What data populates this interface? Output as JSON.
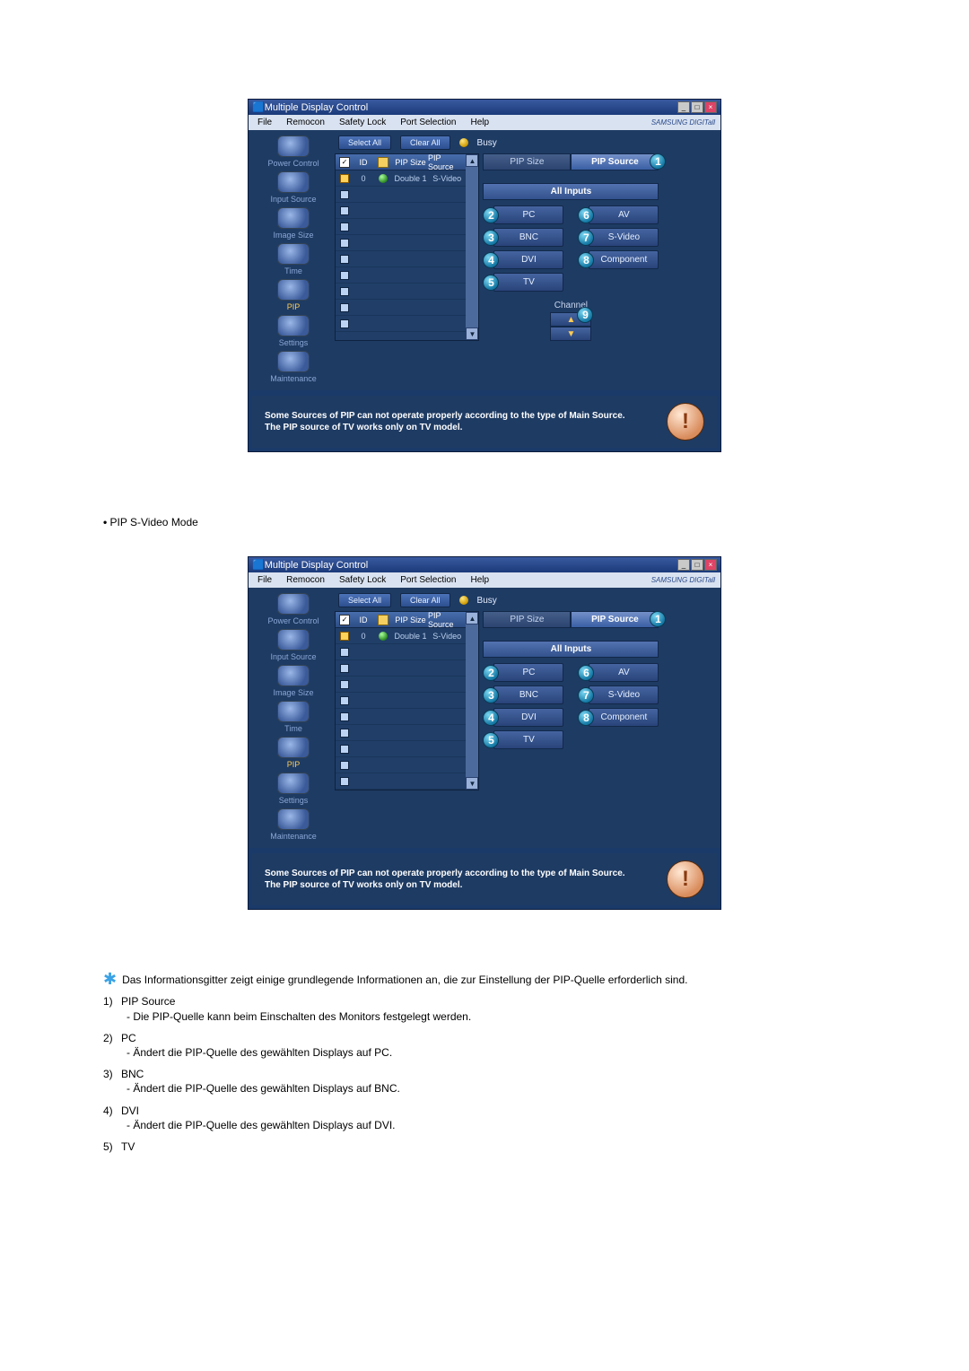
{
  "doc": {
    "mode_bullet": "PIP S-Video Mode",
    "note_text": "Das Informationsgitter zeigt einige grundlegende Informationen an, die zur Einstellung der PIP-Quelle erforderlich sind.",
    "items": [
      {
        "num": "1)",
        "title": "PIP Source",
        "sub": "- Die PIP-Quelle kann beim Einschalten des Monitors festgelegt werden."
      },
      {
        "num": "2)",
        "title": "PC",
        "sub": "- Ändert die PIP-Quelle des gewählten Displays auf PC."
      },
      {
        "num": "3)",
        "title": "BNC",
        "sub": "- Ändert die PIP-Quelle des gewählten Displays auf BNC."
      },
      {
        "num": "4)",
        "title": "DVI",
        "sub": "- Ändert die PIP-Quelle des gewählten Displays auf DVI."
      },
      {
        "num": "5)",
        "title": "TV",
        "sub": ""
      }
    ]
  },
  "shared": {
    "window_title": "Multiple Display Control",
    "menus": {
      "file": "File",
      "remocon": "Remocon",
      "safety_lock": "Safety Lock",
      "port_selection": "Port Selection",
      "help": "Help"
    },
    "brand": "SAMSUNG DIGITall",
    "nav": {
      "power": "Power Control",
      "input": "Input Source",
      "image": "Image Size",
      "time": "Time",
      "pip": "PIP",
      "settings": "Settings",
      "maint": "Maintenance"
    },
    "toolbar": {
      "select_all": "Select All",
      "clear_all": "Clear All",
      "busy": "Busy"
    },
    "grid": {
      "hdr_id": "ID",
      "hdr_pip_size": "PIP Size",
      "hdr_pip_source": "PIP Source",
      "row0_id": "0",
      "row0_size": "Double 1",
      "row0_src": "S-Video"
    },
    "panel": {
      "tab_pip_size": "PIP Size",
      "tab_pip_source": "PIP Source",
      "all_inputs": "All Inputs",
      "pc": "PC",
      "bnc": "BNC",
      "dvi": "DVI",
      "tv": "TV",
      "av": "AV",
      "svideo": "S-Video",
      "component": "Component",
      "channel": "Channel"
    },
    "footer": {
      "line1": "Some Sources of PIP can not operate properly according to the type of Main Source.",
      "line2": "The PIP source of TV works only on TV model."
    },
    "numbers": {
      "n1": "1",
      "n2": "2",
      "n3": "3",
      "n4": "4",
      "n5": "5",
      "n6": "6",
      "n7": "7",
      "n8": "8",
      "n9": "9"
    }
  },
  "screenshots": [
    {
      "show_channel": true
    },
    {
      "show_channel": false
    }
  ]
}
